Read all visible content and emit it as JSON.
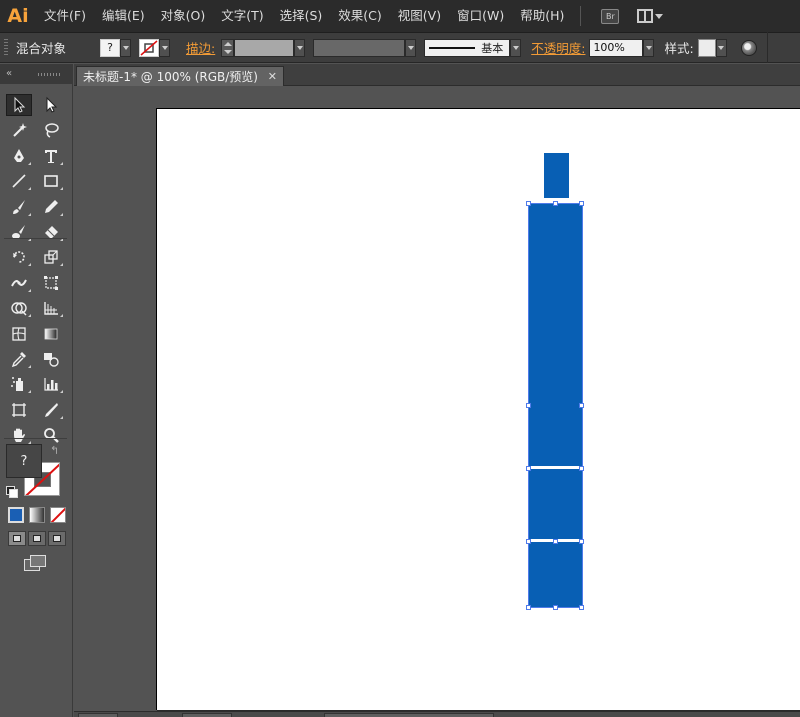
{
  "app": {
    "logo": "Ai"
  },
  "menu": [
    "文件(F)",
    "编辑(E)",
    "对象(O)",
    "文字(T)",
    "选择(S)",
    "效果(C)",
    "视图(V)",
    "窗口(W)",
    "帮助(H)"
  ],
  "menu_extras": {
    "bridge_label": "Br"
  },
  "control": {
    "selection_label": "混合对象",
    "fill_value": "?",
    "stroke_label": "描边:",
    "profile_label": "基本",
    "opacity_label": "不透明度:",
    "opacity_value": "100%",
    "style_label": "样式:"
  },
  "tools": [
    "selection",
    "direct-selection",
    "magic-wand",
    "lasso",
    "pen",
    "type",
    "line-segment",
    "rectangle",
    "paintbrush",
    "pencil",
    "blob-brush",
    "eraser",
    "rotate",
    "scale",
    "width",
    "free-transform",
    "shape-builder",
    "perspective-grid",
    "mesh",
    "gradient",
    "eyedropper",
    "blend",
    "symbol-sprayer",
    "column-graph",
    "artboard",
    "slice",
    "hand",
    "zoom"
  ],
  "toolbar": {
    "fill_value": "?"
  },
  "document": {
    "tab_title": "未标题-1* @ 100% (RGB/预览)",
    "close_glyph": "✕"
  },
  "colors": {
    "accent_orange": "#f29b36",
    "shape_blue": "#085fb4",
    "selection_blue": "#4f7bea"
  }
}
